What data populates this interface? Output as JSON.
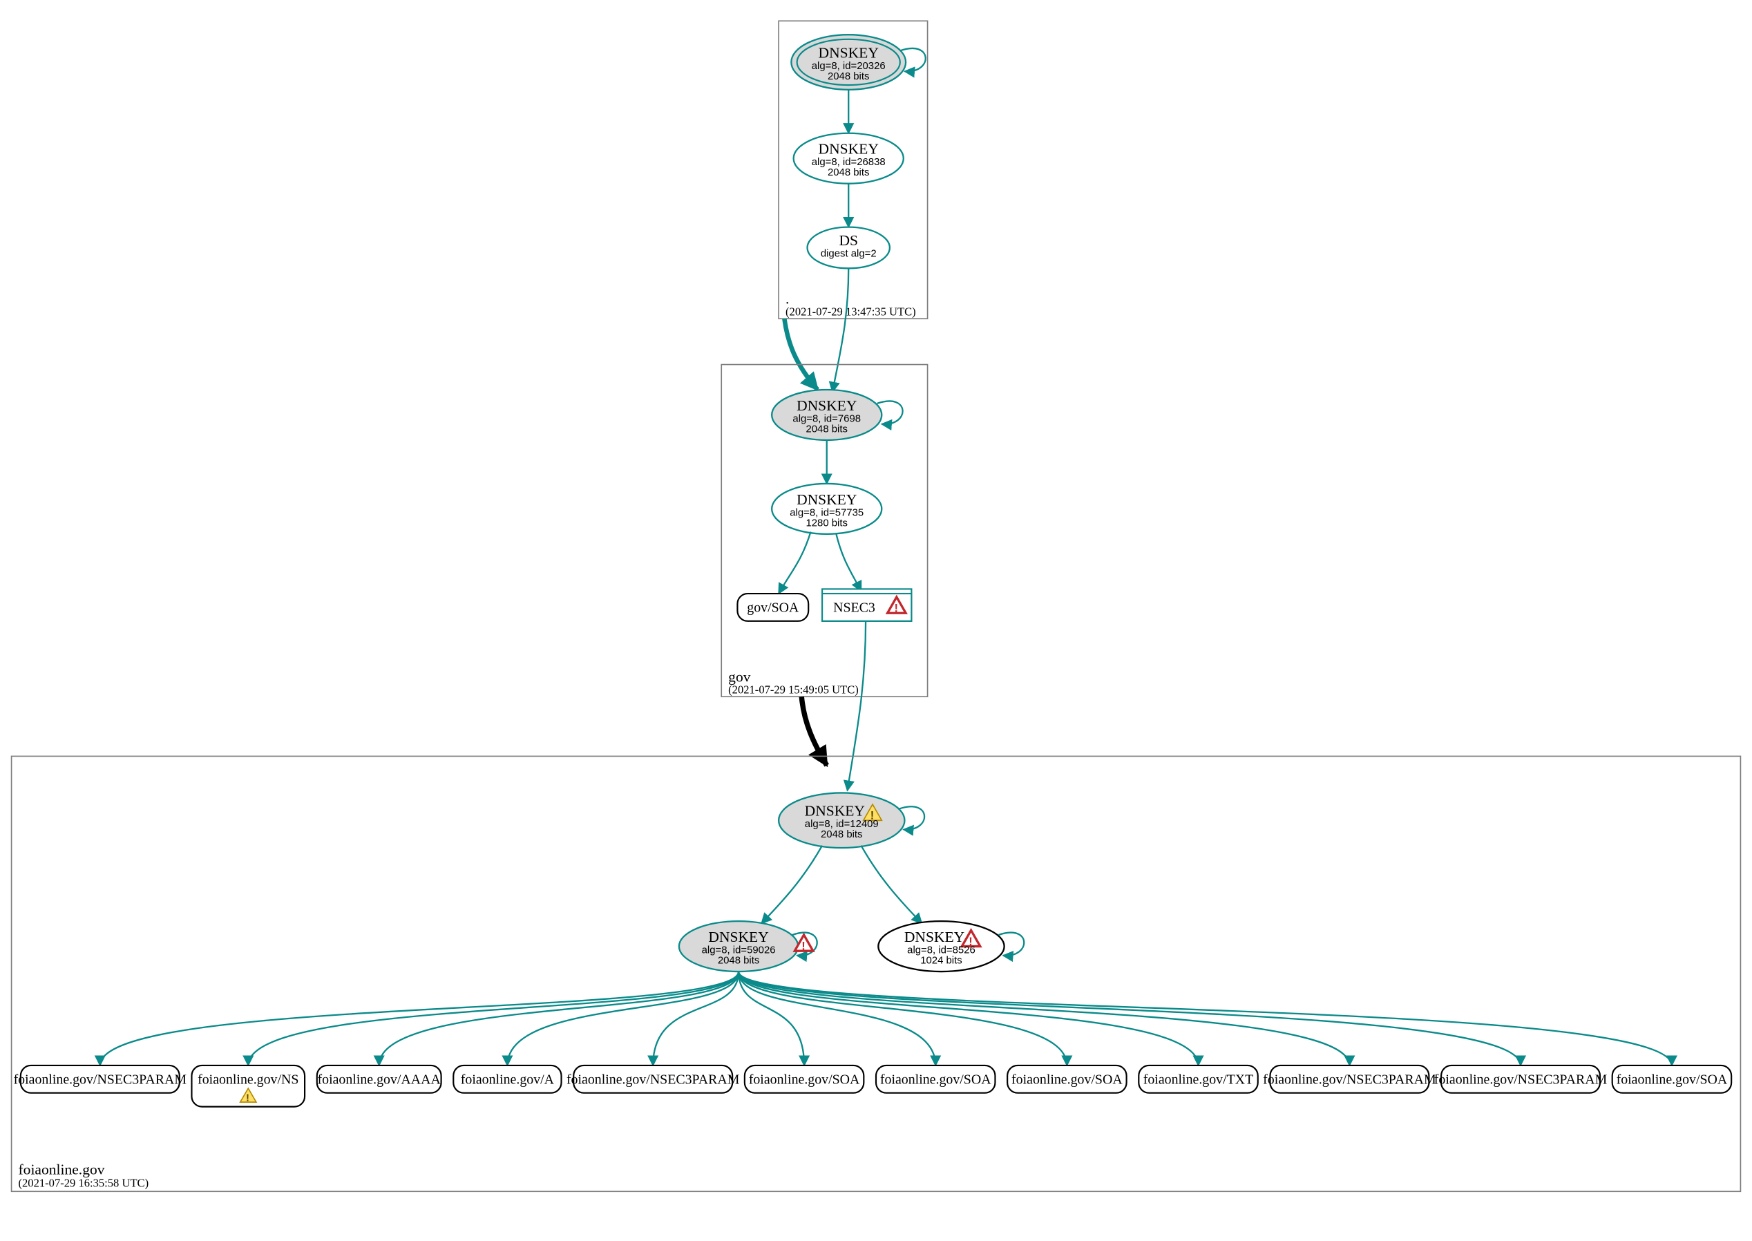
{
  "zones": {
    "root": {
      "label": ".",
      "timestamp": "(2021-07-29 13:47:35 UTC)"
    },
    "gov": {
      "label": "gov",
      "timestamp": "(2021-07-29 15:49:05 UTC)"
    },
    "foia": {
      "label": "foiaonline.gov",
      "timestamp": "(2021-07-29 16:35:58 UTC)"
    }
  },
  "nodes": {
    "root_ksk": {
      "title": "DNSKEY",
      "l1": "alg=8, id=20326",
      "l2": "2048 bits"
    },
    "root_zsk": {
      "title": "DNSKEY",
      "l1": "alg=8, id=26838",
      "l2": "2048 bits"
    },
    "root_ds": {
      "title": "DS",
      "l1": "digest alg=2"
    },
    "gov_ksk": {
      "title": "DNSKEY",
      "l1": "alg=8, id=7698",
      "l2": "2048 bits"
    },
    "gov_zsk": {
      "title": "DNSKEY",
      "l1": "alg=8, id=57735",
      "l2": "1280 bits"
    },
    "gov_soa": {
      "label": "gov/SOA"
    },
    "gov_nsec": {
      "label": "NSEC3"
    },
    "foia_ksk": {
      "title": "DNSKEY",
      "l1": "alg=8, id=12409",
      "l2": "2048 bits"
    },
    "foia_zsk": {
      "title": "DNSKEY",
      "l1": "alg=8, id=59026",
      "l2": "2048 bits"
    },
    "foia_key2": {
      "title": "DNSKEY",
      "l1": "alg=8, id=8526",
      "l2": "1024 bits"
    }
  },
  "rrsets": [
    "foiaonline.gov/NSEC3PARAM",
    "foiaonline.gov/NS",
    "foiaonline.gov/AAAA",
    "foiaonline.gov/A",
    "foiaonline.gov/NSEC3PARAM",
    "foiaonline.gov/SOA",
    "foiaonline.gov/SOA",
    "foiaonline.gov/SOA",
    "foiaonline.gov/TXT",
    "foiaonline.gov/NSEC3PARAM",
    "foiaonline.gov/NSEC3PARAM",
    "foiaonline.gov/SOA"
  ],
  "rrset_ns_warning_index": 1
}
